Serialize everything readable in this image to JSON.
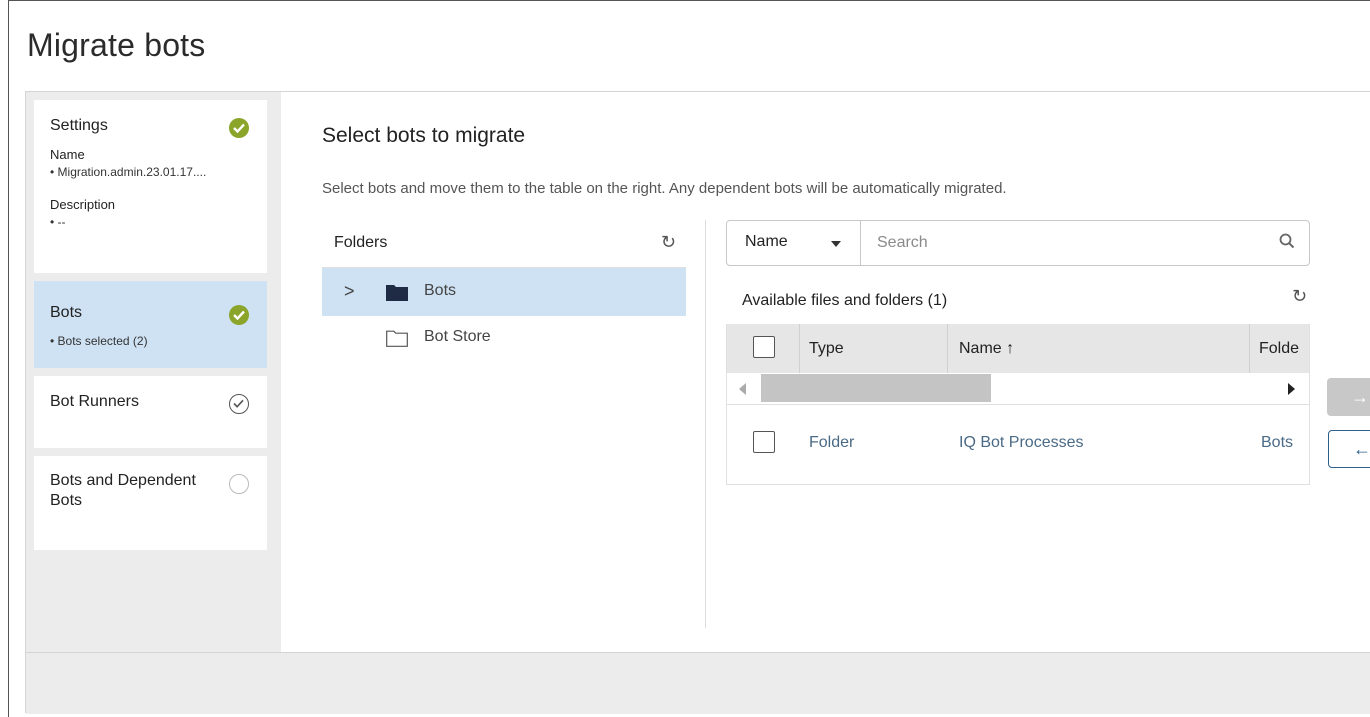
{
  "page": {
    "title": "Migrate bots"
  },
  "steps": [
    {
      "title": "Settings",
      "status": "complete",
      "details": [
        {
          "label": "Name",
          "value": "• Migration.admin.23.01.17...."
        },
        {
          "label": "Description",
          "value": "• --"
        }
      ]
    },
    {
      "title": "Bots",
      "status": "complete",
      "active": true,
      "summary": "• Bots selected (2)"
    },
    {
      "title": "Bot Runners",
      "status": "outline-check"
    },
    {
      "title": "Bots and Dependent Bots",
      "status": "pending"
    }
  ],
  "content": {
    "title": "Select bots to migrate",
    "description": "Select bots and move them to the table on the right. Any dependent bots will be automatically migrated."
  },
  "folders": {
    "header": "Folders",
    "items": [
      {
        "label": "Bots",
        "icon": "folder-filled-icon",
        "expandable": true,
        "selected": true
      },
      {
        "label": "Bot Store",
        "icon": "folder-outline-icon",
        "expandable": false,
        "selected": false
      }
    ]
  },
  "search": {
    "field": "Name",
    "placeholder": "Search",
    "value": ""
  },
  "available": {
    "title": "Available files and folders (1)",
    "columns": [
      "Type",
      "Name",
      "Folde"
    ],
    "sort_indicator": "↑",
    "rows": [
      {
        "type": "Folder",
        "name": "IQ Bot Processes",
        "folder": "Bots"
      }
    ]
  },
  "transfer": {
    "move_right": "→",
    "move_left": "←"
  },
  "colors": {
    "accent": "#2c5f8a",
    "success": "#8aa52a",
    "selected_bg": "#cfe2f3",
    "link_text": "#4a6a86"
  }
}
